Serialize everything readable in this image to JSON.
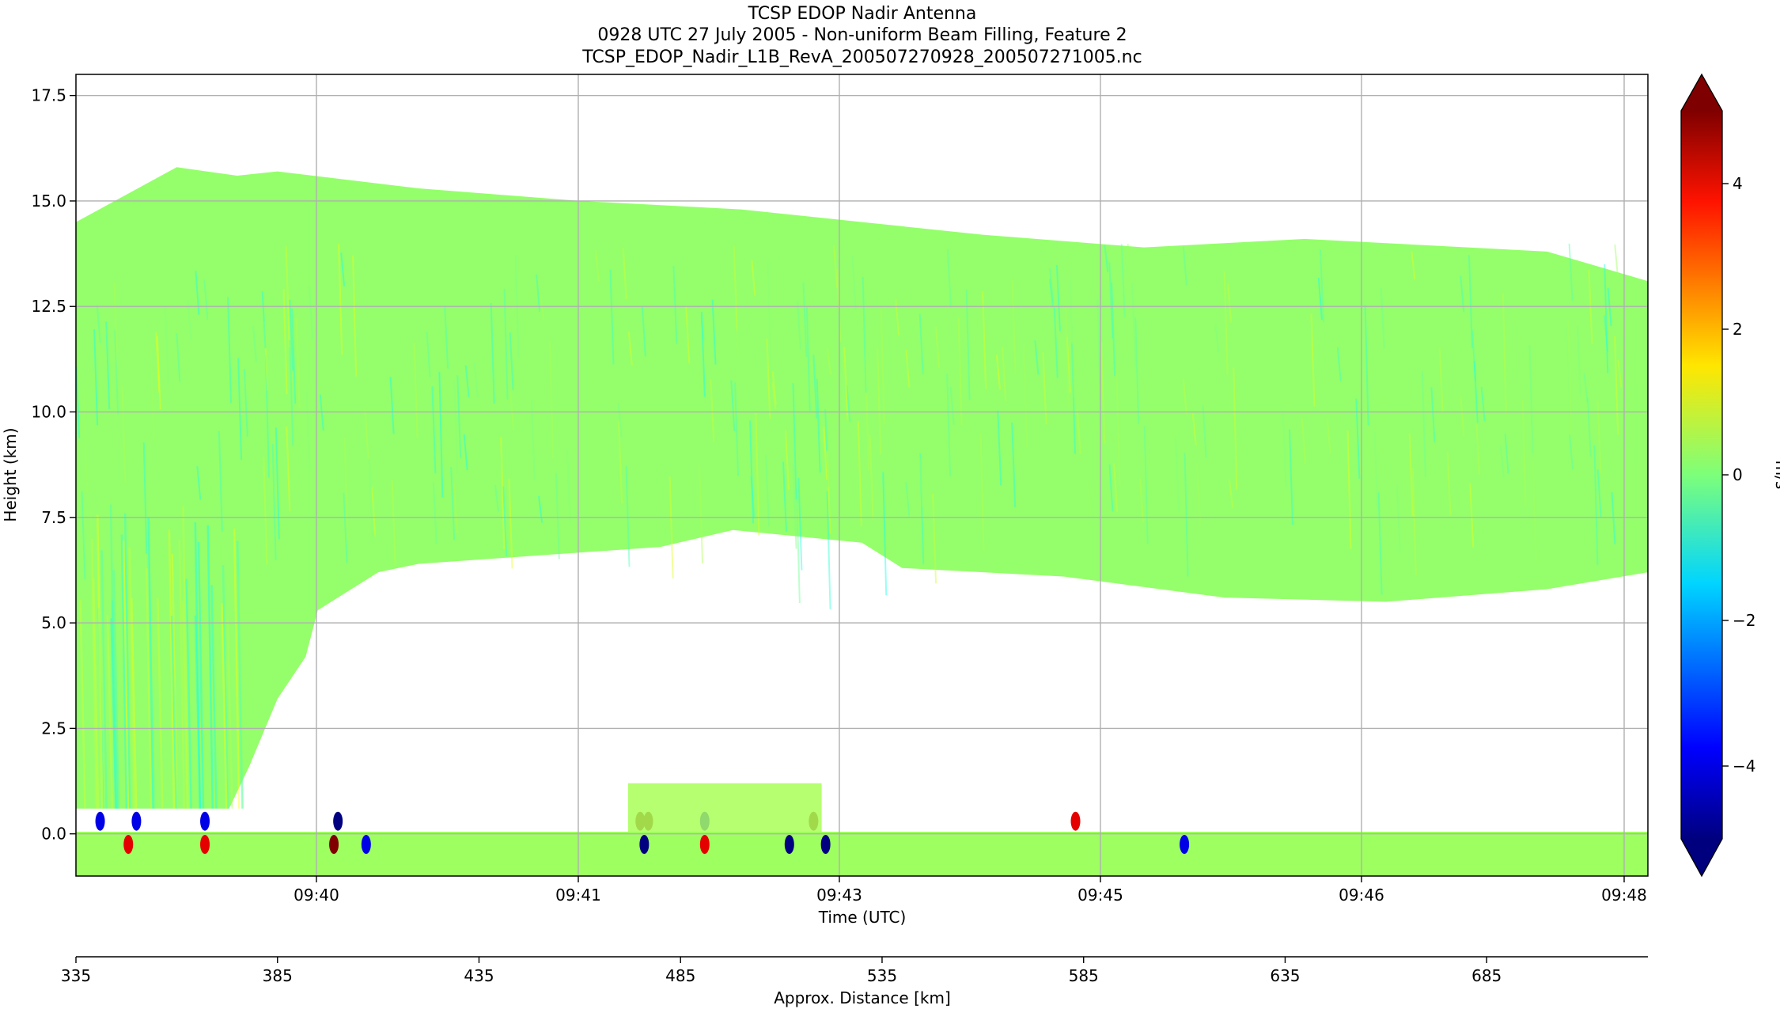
{
  "chart_data": {
    "type": "heatmap",
    "title_lines": [
      "TCSP EDOP Nadir Antenna",
      "0928 UTC 27 July 2005 - Non-uniform Beam Filling, Feature 2",
      "TCSP_EDOP_Nadir_L1B_RevA_200507270928_200507271005.nc"
    ],
    "xlabel": "Time (UTC)",
    "ylabel": "Height (km)",
    "x_ticks": [
      "09:40",
      "09:41",
      "09:43",
      "09:45",
      "09:46",
      "09:48"
    ],
    "ylim": [
      -1,
      18
    ],
    "y_ticks": [
      0.0,
      2.5,
      5.0,
      7.5,
      10.0,
      12.5,
      15.0,
      17.5
    ],
    "secondary_axis": {
      "label": "Approx. Distance [km]",
      "range": [
        335,
        725
      ],
      "ticks": [
        335,
        385,
        435,
        485,
        535,
        585,
        635,
        685
      ]
    },
    "colorbar": {
      "label": "m/s",
      "range": [
        -5,
        5
      ],
      "ticks": [
        -4,
        -2,
        0,
        2,
        4
      ],
      "extend": "both",
      "colormap": "jet"
    },
    "grid": true,
    "field": {
      "cloud_top_km": [
        [
          335,
          14.5
        ],
        [
          360,
          15.8
        ],
        [
          375,
          15.6
        ],
        [
          385,
          15.7
        ],
        [
          420,
          15.3
        ],
        [
          460,
          15.0
        ],
        [
          500,
          14.8
        ],
        [
          530,
          14.5
        ],
        [
          560,
          14.2
        ],
        [
          600,
          13.9
        ],
        [
          640,
          14.1
        ],
        [
          700,
          13.8
        ],
        [
          725,
          13.1
        ]
      ],
      "cloud_base_km": [
        [
          395,
          5.3
        ],
        [
          410,
          6.2
        ],
        [
          420,
          6.4
        ],
        [
          450,
          6.6
        ],
        [
          480,
          6.8
        ],
        [
          498,
          7.2
        ],
        [
          530,
          6.9
        ],
        [
          540,
          6.3
        ],
        [
          580,
          6.1
        ],
        [
          620,
          5.6
        ],
        [
          660,
          5.5
        ],
        [
          700,
          5.8
        ],
        [
          725,
          6.2
        ]
      ],
      "dominant_value_ms": 0.2
    }
  }
}
